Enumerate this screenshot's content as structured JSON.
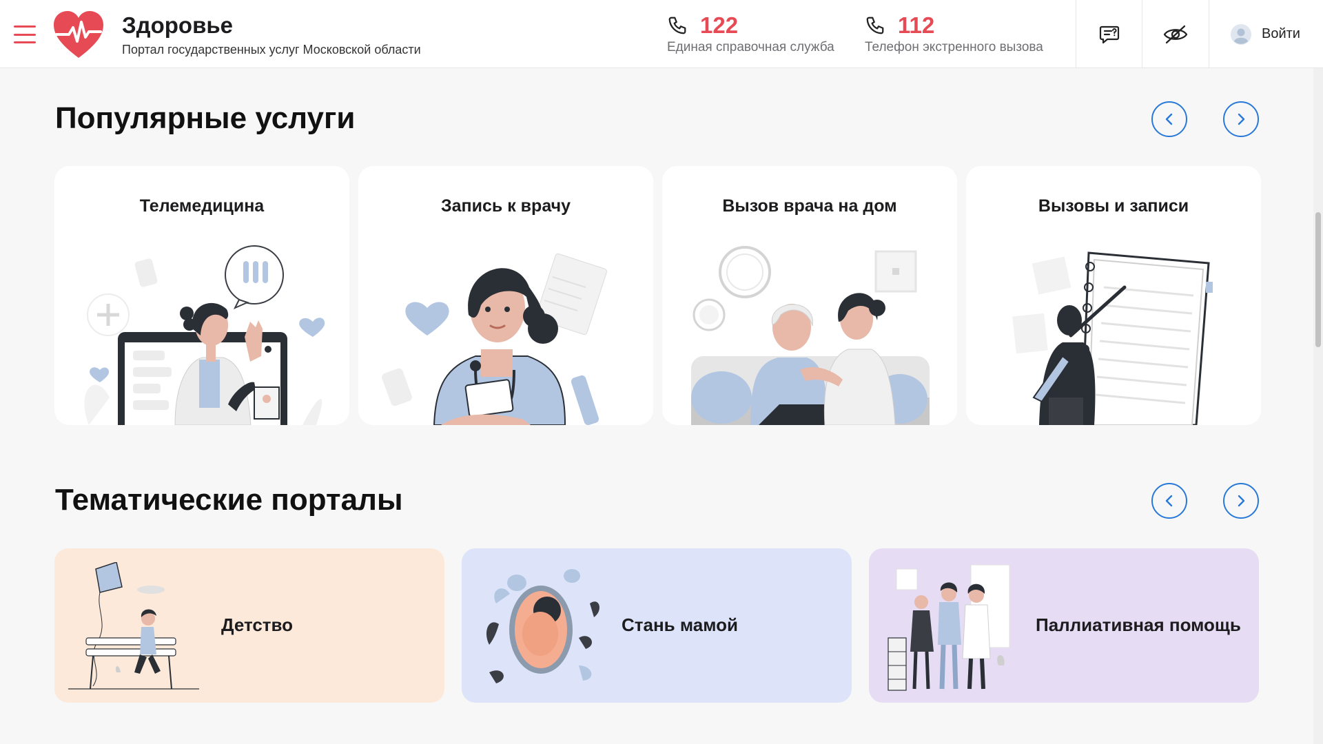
{
  "header": {
    "title": "Здоровье",
    "subtitle": "Портал государственных услуг Московской области",
    "phones": [
      {
        "number": "122",
        "label": "Единая справочная служба"
      },
      {
        "number": "112",
        "label": "Телефон экстренного вызова"
      }
    ],
    "login_label": "Войти"
  },
  "popular": {
    "title": "Популярные услуги",
    "cards": [
      {
        "title": "Телемедицина"
      },
      {
        "title": "Запись к врачу"
      },
      {
        "title": "Вызов врача на дом"
      },
      {
        "title": "Вызовы и записи"
      }
    ]
  },
  "portals": {
    "title": "Тематические порталы",
    "items": [
      {
        "label": "Детство",
        "bg": "#fde9d9"
      },
      {
        "label": "Стань мамой",
        "bg": "#dde4fa"
      },
      {
        "label": "Паллиативная помощь",
        "bg": "#e6dcf3"
      }
    ]
  },
  "colors": {
    "accent": "#e64a55",
    "link": "#2878d8",
    "illus_blue": "#b2c6e2",
    "illus_dark": "#2a2e35"
  }
}
